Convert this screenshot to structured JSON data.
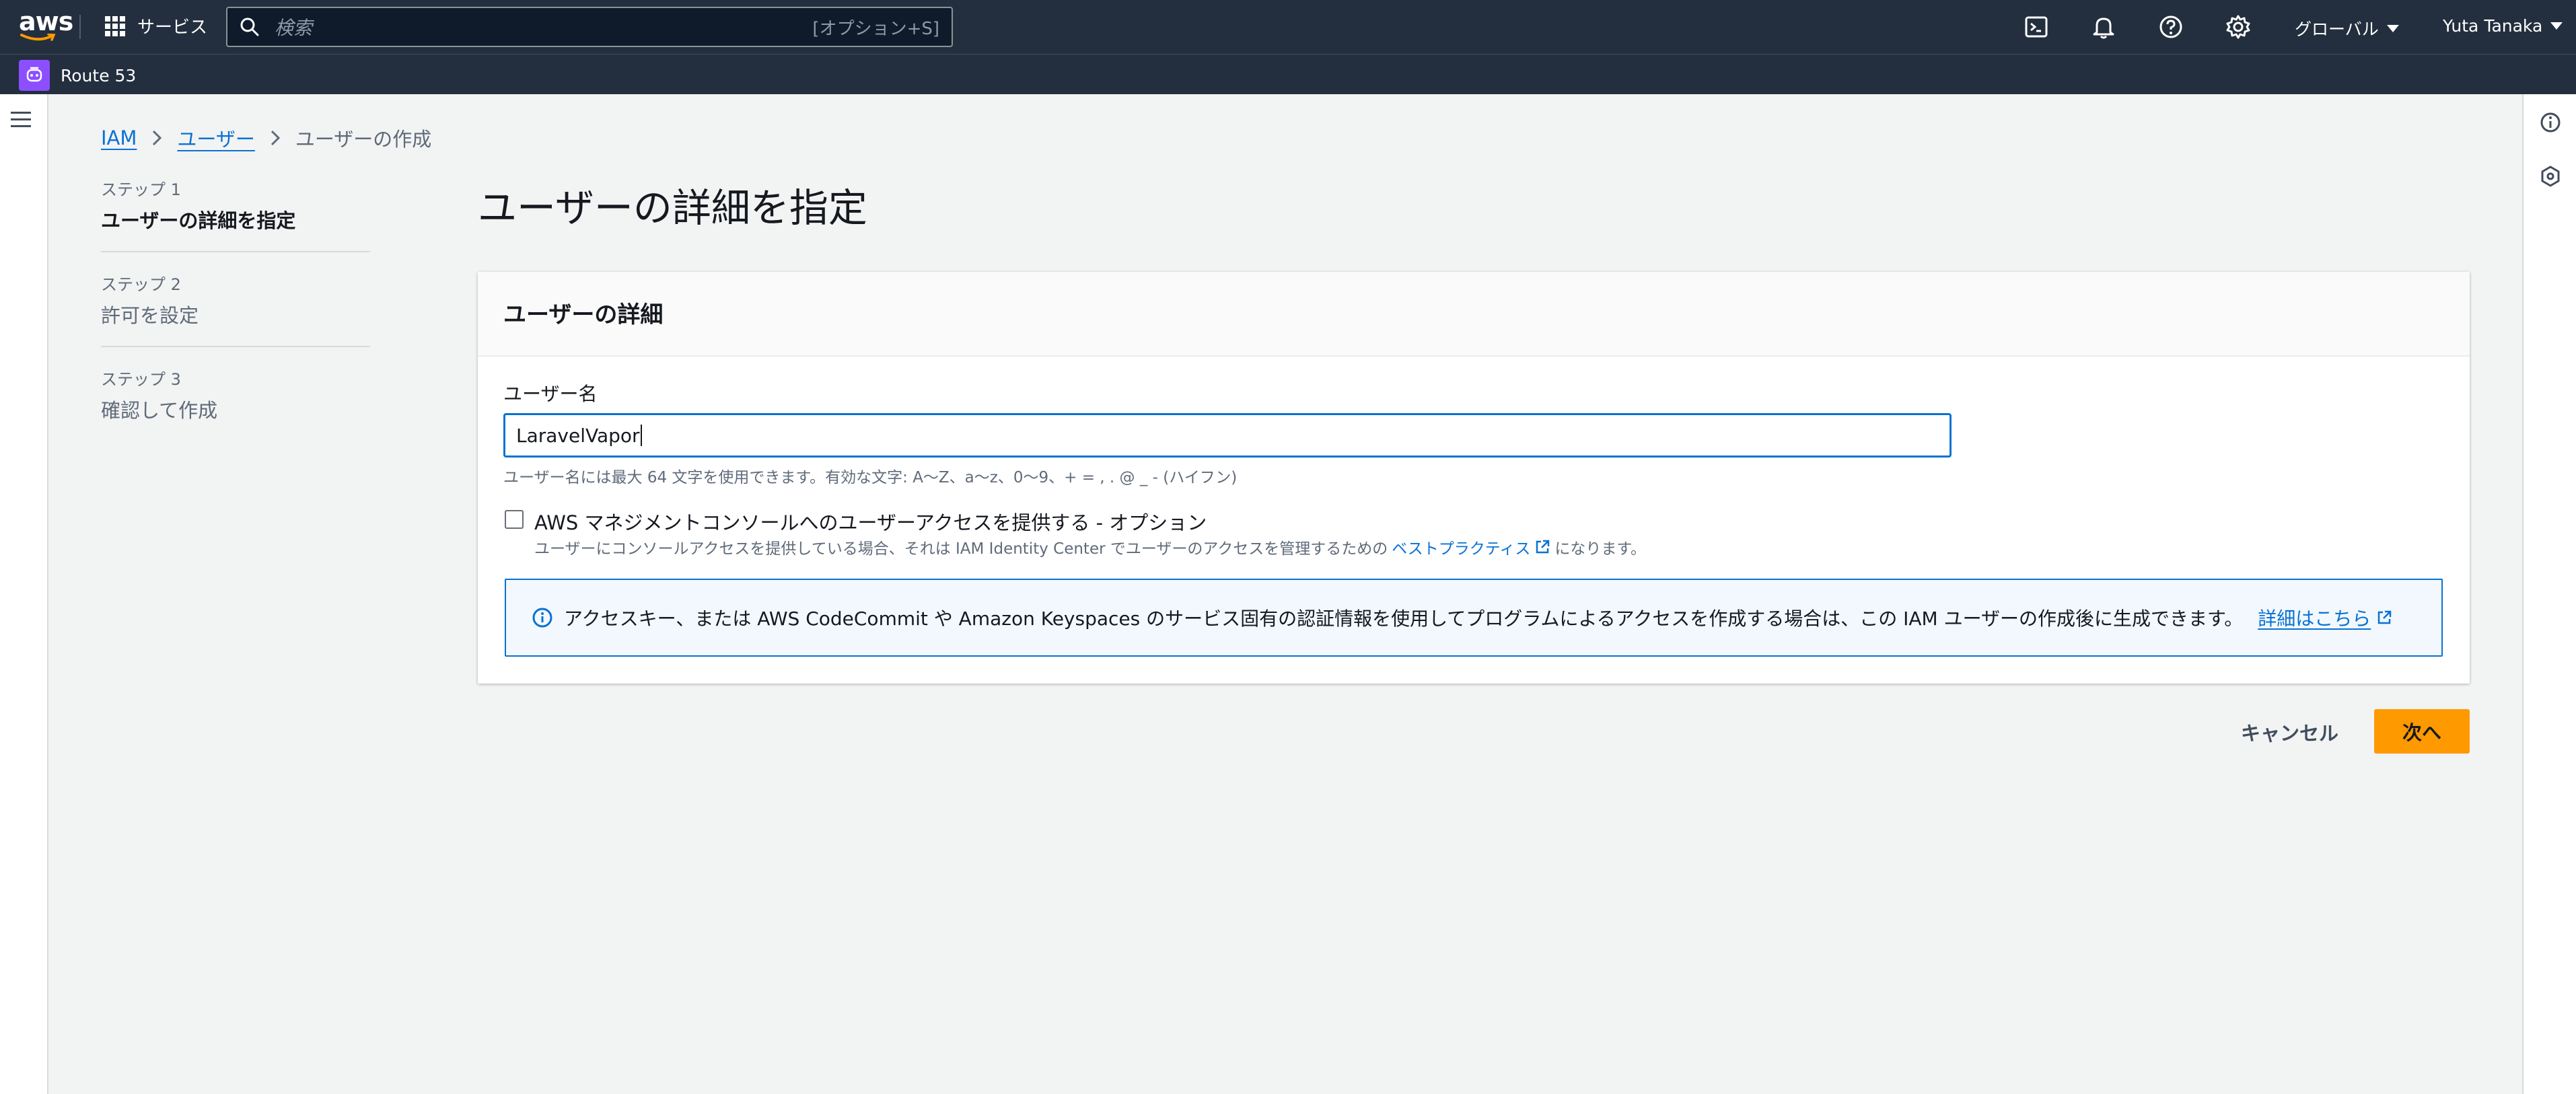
{
  "topnav": {
    "logo_text": "aws",
    "services_label": "サービス",
    "search_placeholder": "検索",
    "search_shortcut": "[オプション+S]",
    "region_label": "グローバル",
    "user_label": "Yuta Tanaka",
    "icons": [
      "cloudshell-icon",
      "bell-icon",
      "help-icon",
      "gear-icon"
    ]
  },
  "servicebar": {
    "service_name": "Route 53"
  },
  "breadcrumb": {
    "items": [
      "IAM",
      "ユーザー",
      "ユーザーの作成"
    ]
  },
  "steps": [
    {
      "number": "ステップ 1",
      "name": "ユーザーの詳細を指定"
    },
    {
      "number": "ステップ 2",
      "name": "許可を設定"
    },
    {
      "number": "ステップ 3",
      "name": "確認して作成"
    }
  ],
  "main": {
    "page_title": "ユーザーの詳細を指定",
    "container_title": "ユーザーの詳細",
    "username_label": "ユーザー名",
    "username_value": "LaravelVapor",
    "username_constraint": "ユーザー名には最大 64 文字を使用できます。有効な文字: A〜Z、a〜z、0〜9、+ = , . @ _ - (ハイフン)",
    "console_access_label": "AWS マネジメントコンソールへのユーザーアクセスを提供する - オプション",
    "console_access_desc_before": "ユーザーにコンソールアクセスを提供している場合、それは IAM Identity Center でユーザーのアクセスを管理するための",
    "console_access_link": "ベストプラクティス",
    "console_access_desc_after": "になります。",
    "info_text": "アクセスキー、または AWS CodeCommit や Amazon Keyspaces のサービス固有の認証情報を使用してプログラムによるアクセスを作成する場合は、この IAM ユーザーの作成後に生成できます。",
    "info_link": "詳細はこちら"
  },
  "footer": {
    "cancel_label": "キャンセル",
    "next_label": "次へ"
  },
  "colors": {
    "nav_bg": "#232f3e",
    "link": "#0972d3",
    "primary_button": "#ff9900",
    "route53_icon": "#8c4fff"
  }
}
